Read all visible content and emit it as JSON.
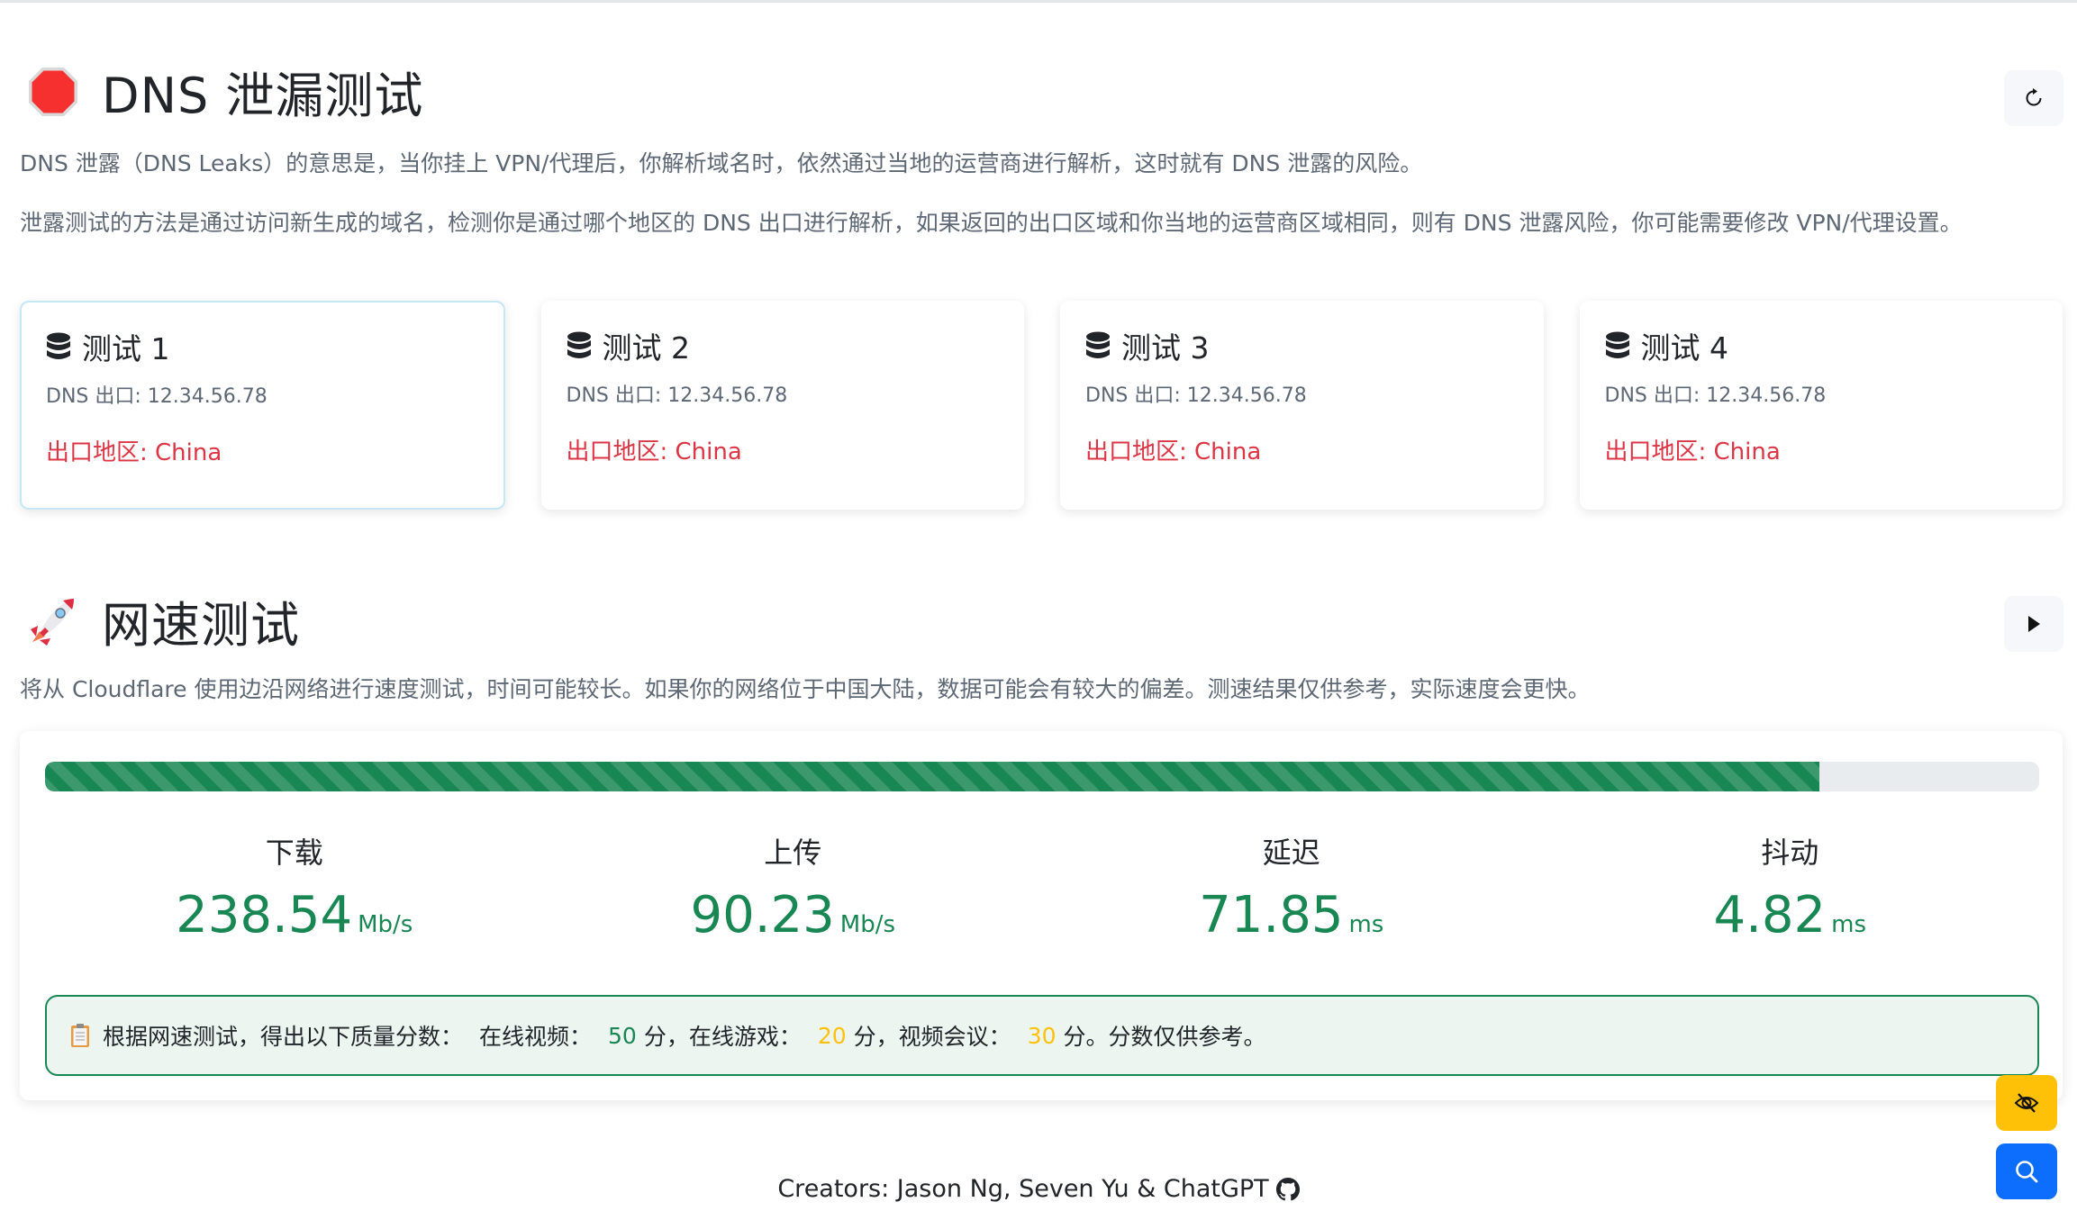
{
  "dns_section": {
    "title": "DNS 泄漏测试",
    "icon": "stop-sign-icon",
    "description_1": "DNS 泄露（DNS Leaks）的意思是，当你挂上 VPN/代理后，你解析域名时，依然通过当地的运营商进行解析，这时就有 DNS 泄露的风险。",
    "description_2": "泄露测试的方法是通过访问新生成的域名，检测你是通过哪个地区的 DNS 出口进行解析，如果返回的出口区域和你当地的运营商区域相同，则有 DNS 泄露风险，你可能需要修改 VPN/代理设置。",
    "refresh_button": "refresh-icon",
    "cards": [
      {
        "title": "测试 1",
        "ip_label": "DNS 出口: 12.34.56.78",
        "region_label": "出口地区: China"
      },
      {
        "title": "测试 2",
        "ip_label": "DNS 出口: 12.34.56.78",
        "region_label": "出口地区: China"
      },
      {
        "title": "测试 3",
        "ip_label": "DNS 出口: 12.34.56.78",
        "region_label": "出口地区: China"
      },
      {
        "title": "测试 4",
        "ip_label": "DNS 出口: 12.34.56.78",
        "region_label": "出口地区: China"
      }
    ]
  },
  "speed_section": {
    "title": "网速测试",
    "icon": "rocket-icon",
    "description": "将从 Cloudflare 使用边沿网络进行速度测试，时间可能较长。如果你的网络位于中国大陆，数据可能会有较大的偏差。测速结果仅供参考，实际速度会更快。",
    "start_button": "play-icon",
    "progress_percent": 89,
    "metrics": [
      {
        "label": "下载",
        "value": "238.54",
        "unit": "Mb/s"
      },
      {
        "label": "上传",
        "value": "90.23",
        "unit": "Mb/s"
      },
      {
        "label": "延迟",
        "value": "71.85",
        "unit": "ms"
      },
      {
        "label": "抖动",
        "value": "4.82",
        "unit": "ms"
      }
    ],
    "score": {
      "prefix": "根据网速测试，得出以下质量分数：",
      "video_label": "在线视频：",
      "video_score": "50",
      "game_label": "分，在线游戏：",
      "game_score": "20",
      "meeting_label": "分，视频会议：",
      "meeting_score": "30",
      "suffix": "分。分数仅供参考。"
    }
  },
  "floating_buttons": {
    "hide_button": "eye-slash-icon",
    "search_button": "search-icon"
  },
  "footer": {
    "text": "Creators: Jason Ng, Seven Yu & ChatGPT",
    "icon": "github-icon"
  },
  "colors": {
    "success": "#198754",
    "danger": "#dc3545",
    "warning": "#ffc107",
    "primary": "#0d6efd"
  }
}
